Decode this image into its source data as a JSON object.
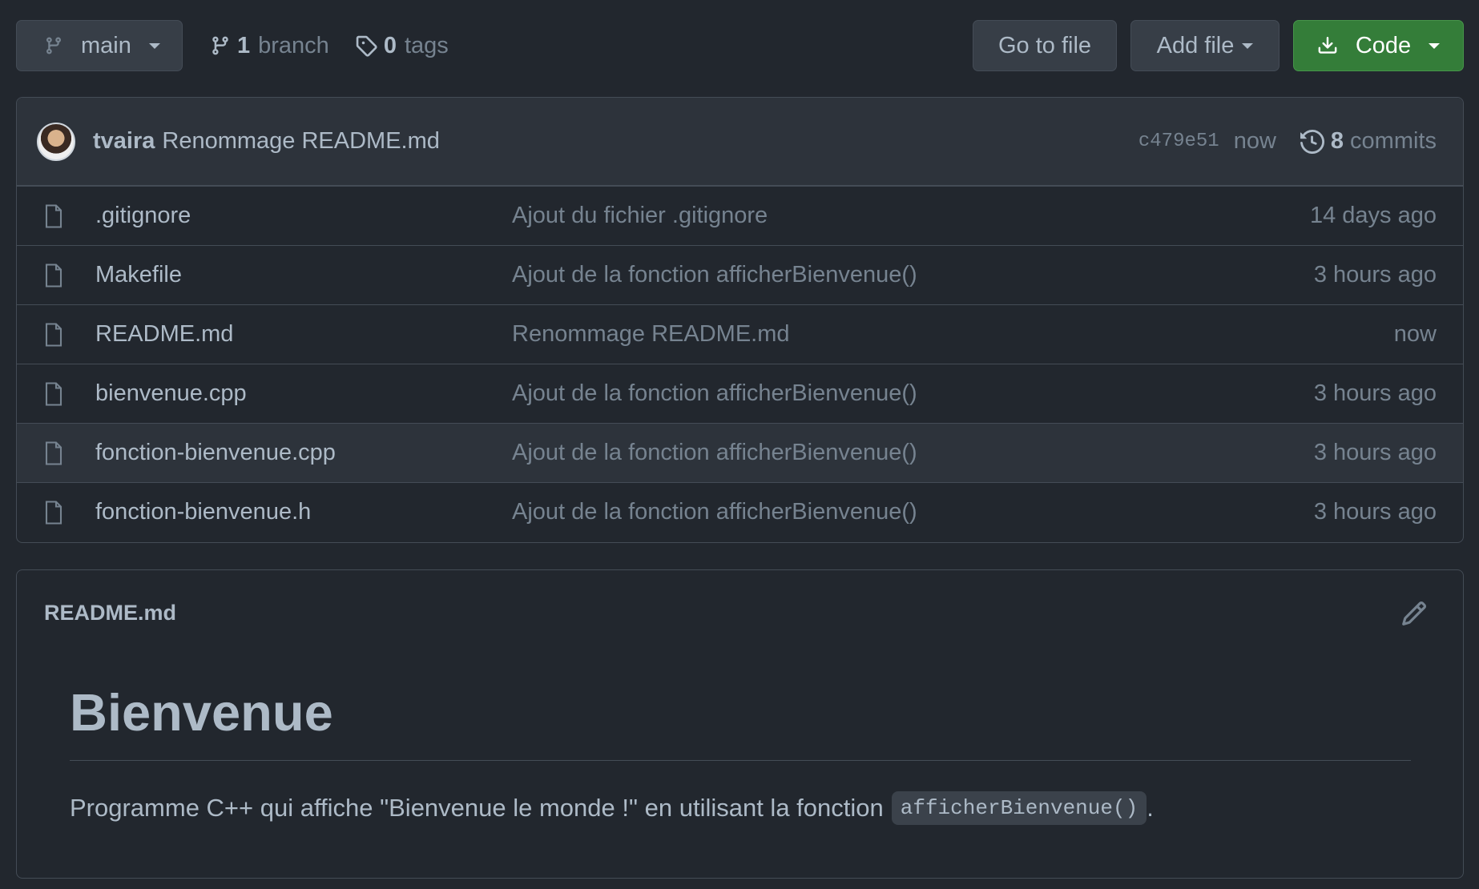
{
  "toolbar": {
    "branch_name": "main",
    "branches_count": "1",
    "branches_label": "branch",
    "tags_count": "0",
    "tags_label": "tags",
    "goto_file_label": "Go to file",
    "add_file_label": "Add file",
    "code_label": "Code"
  },
  "latest_commit": {
    "author": "tvaira",
    "message": "Renommage README.md",
    "sha": "c479e51",
    "time": "now",
    "commits_count": "8",
    "commits_label": "commits"
  },
  "files": [
    {
      "name": ".gitignore",
      "message": "Ajout du fichier .gitignore",
      "time": "14 days ago"
    },
    {
      "name": "Makefile",
      "message": "Ajout de la fonction afficherBienvenue()",
      "time": "3 hours ago"
    },
    {
      "name": "README.md",
      "message": "Renommage README.md",
      "time": "now"
    },
    {
      "name": "bienvenue.cpp",
      "message": "Ajout de la fonction afficherBienvenue()",
      "time": "3 hours ago"
    },
    {
      "name": "fonction-bienvenue.cpp",
      "message": "Ajout de la fonction afficherBienvenue()",
      "time": "3 hours ago"
    },
    {
      "name": "fonction-bienvenue.h",
      "message": "Ajout de la fonction afficherBienvenue()",
      "time": "3 hours ago"
    }
  ],
  "readme": {
    "filename": "README.md",
    "heading": "Bienvenue",
    "paragraph_text": "Programme C++ qui affiche \"Bienvenue le monde !\" en utilisant la fonction",
    "inline_code": "afficherBienvenue()",
    "trailing_text": "."
  },
  "colors": {
    "background": "#22272e",
    "surface": "#2d333b",
    "border": "#444c56",
    "text": "#adbac7",
    "muted": "#768390",
    "primary_button": "#347d39"
  },
  "icons": {
    "branch": "git-branch-icon",
    "tag": "tag-icon",
    "download": "download-icon",
    "history": "history-icon",
    "file": "file-icon",
    "edit": "pencil-icon"
  }
}
